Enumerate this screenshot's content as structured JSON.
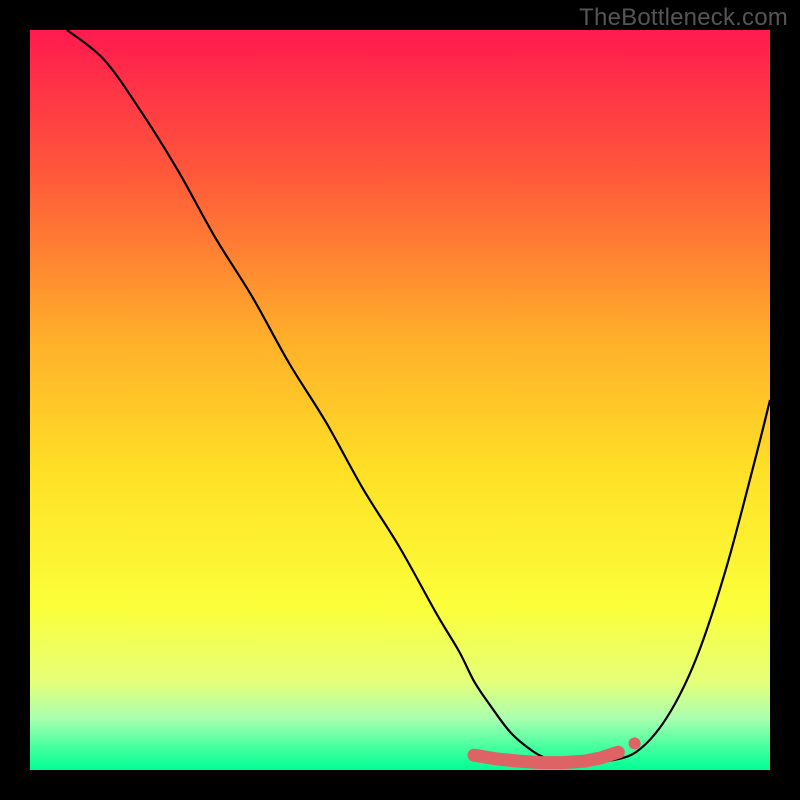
{
  "watermark": "TheBottleneck.com",
  "colors": {
    "frame": "#000000",
    "watermark_text": "#555558",
    "curve": "#000000",
    "marker_fill": "#de6364",
    "marker_stroke": "#de6364"
  },
  "chart_data": {
    "type": "line",
    "title": "",
    "xlabel": "",
    "ylabel": "",
    "xlim": [
      0,
      100
    ],
    "ylim": [
      0,
      100
    ],
    "grid": false,
    "gradient_stops": [
      {
        "offset": 0.0,
        "color": "#ff1a4f"
      },
      {
        "offset": 0.2,
        "color": "#ff5a3a"
      },
      {
        "offset": 0.42,
        "color": "#ffb02a"
      },
      {
        "offset": 0.6,
        "color": "#ffe126"
      },
      {
        "offset": 0.78,
        "color": "#fbff3a"
      },
      {
        "offset": 0.88,
        "color": "#e6ff78"
      },
      {
        "offset": 0.93,
        "color": "#aaffb0"
      },
      {
        "offset": 0.97,
        "color": "#44ff9f"
      },
      {
        "offset": 1.0,
        "color": "#00ff95"
      }
    ],
    "series": [
      {
        "name": "bottleneck-curve",
        "x": [
          5,
          10,
          15,
          20,
          25,
          30,
          35,
          40,
          45,
          50,
          55,
          58,
          60,
          62,
          65,
          68,
          70,
          72,
          75,
          78,
          82,
          86,
          90,
          94,
          98,
          100
        ],
        "y": [
          100,
          96,
          89,
          81,
          72,
          64,
          55,
          47,
          38,
          30,
          21,
          16,
          12,
          9,
          5,
          2.5,
          1.5,
          1,
          1,
          1.2,
          2.5,
          7,
          15,
          27,
          42,
          50
        ]
      }
    ],
    "flat_markers": {
      "name": "min-bottleneck-band",
      "x": [
        60,
        63,
        66,
        69,
        72,
        75,
        77,
        79.5
      ],
      "y": [
        2.0,
        1.5,
        1.2,
        1.0,
        1.0,
        1.2,
        1.6,
        2.4
      ]
    }
  }
}
